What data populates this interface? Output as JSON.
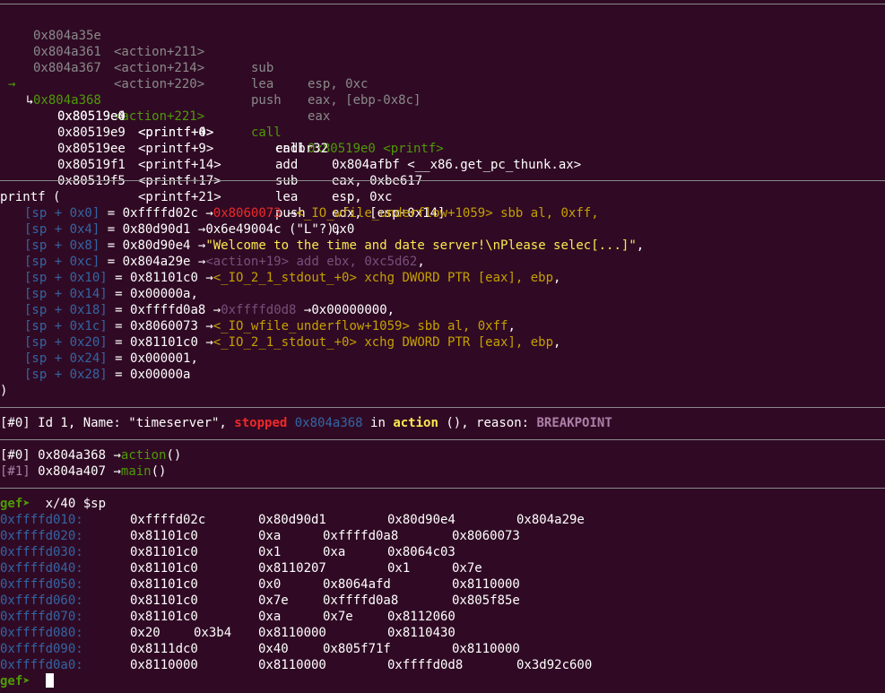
{
  "colors": {
    "background": "#300a24",
    "foreground": "#ffffff",
    "dim": "#8a8a8a",
    "green": "#4e9a06",
    "blue": "#3465a4",
    "red": "#ef2929",
    "orange": "#c4a000",
    "yellow": "#fce94f",
    "purple": "#75507b"
  },
  "disasm_prev": [
    {
      "addr": "0x804a35e",
      "sym": "<action+211>",
      "mnem": "sub",
      "ops": "esp, 0xc"
    },
    {
      "addr": "0x804a361",
      "sym": "<action+214>",
      "mnem": "lea",
      "ops": "eax, [ebp-0x8c]"
    },
    {
      "addr": "0x804a367",
      "sym": "<action+220>",
      "mnem": "push",
      "ops": "eax"
    }
  ],
  "disasm_current": {
    "marker": "→",
    "addr": "0x804a368",
    "sym": "<action+221>",
    "mnem": "call",
    "ops": "0x80519e0 <printf>"
  },
  "disasm_target": {
    "arrow": "↳",
    "first": {
      "addr": "0x80519e0",
      "sym": "<printf+0>",
      "mnem": "endbr32",
      "ops": ""
    },
    "rest": [
      {
        "addr": "0x80519e4",
        "sym": "<printf+4>",
        "mnem": "call",
        "ops": "0x804afbf <__x86.get_pc_thunk.ax>"
      },
      {
        "addr": "0x80519e9",
        "sym": "<printf+9>",
        "mnem": "add",
        "ops": "eax, 0xbe617"
      },
      {
        "addr": "0x80519ee",
        "sym": "<printf+14>",
        "mnem": "sub",
        "ops": "esp, 0xc"
      },
      {
        "addr": "0x80519f1",
        "sym": "<printf+17>",
        "mnem": "lea",
        "ops": "edx, [esp+0x14]"
      },
      {
        "addr": "0x80519f5",
        "sym": "<printf+21>",
        "mnem": "push",
        "ops": "0x0"
      }
    ]
  },
  "args": {
    "open": "printf (",
    "close": ")",
    "rows": [
      {
        "slot": "[sp + 0x0]",
        "val": "0xffffd02c",
        "arrow1": "→",
        "p1": "0x8060073",
        "arrow2": "→",
        "p2": "<_IO_wfile_underflow+1059> sbb al, 0xff,"
      },
      {
        "slot": "[sp + 0x4]",
        "val": "0x80d90d1",
        "arrow1": "→",
        "p1": "0x6e49004c",
        "p2": " (\"L\"?),"
      },
      {
        "slot": "[sp + 0x8]",
        "val": "0x80d90e4",
        "arrow1": "→",
        "p1": "\"Welcome to the time and date server!\\nPlease selec[...]\"",
        "p2": ","
      },
      {
        "slot": "[sp + 0xc]",
        "val": "0x804a29e",
        "arrow1": "→",
        "p1": "<action+19> add ebx, 0xc5d62",
        "p2": ","
      },
      {
        "slot": "[sp + 0x10]",
        "val": "0x81101c0",
        "arrow1": "→",
        "p1": "<_IO_2_1_stdout_+0> xchg DWORD PTR [eax], ebp",
        "p2": ","
      },
      {
        "slot": "[sp + 0x14]",
        "val": "0x00000a,",
        "arrow1": "",
        "p1": "",
        "p2": ""
      },
      {
        "slot": "[sp + 0x18]",
        "val": "0xffffd0a8",
        "arrow1": "→",
        "p1": "0xffffd0d8",
        "arrow2": "→",
        "p2": "0x00000000,"
      },
      {
        "slot": "[sp + 0x1c]",
        "val": "0x8060073",
        "arrow1": "→",
        "p1": "<_IO_wfile_underflow+1059> sbb al, 0xff",
        "p2": ","
      },
      {
        "slot": "[sp + 0x20]",
        "val": "0x81101c0",
        "arrow1": "→",
        "p1": "<_IO_2_1_stdout_+0> xchg DWORD PTR [eax], ebp",
        "p2": ","
      },
      {
        "slot": "[sp + 0x24]",
        "val": "0x000001,",
        "arrow1": "",
        "p1": "",
        "p2": ""
      },
      {
        "slot": "[sp + 0x28]",
        "val": "0x00000a",
        "arrow1": "",
        "p1": "",
        "p2": ""
      }
    ]
  },
  "threads": {
    "idx": "[#0]",
    "id_text": " Id 1, Name: \"timeserver\", ",
    "state": "stopped",
    "addr": "0x804a368",
    "in_text": " in ",
    "func": "action",
    "reason_text": " (), reason: ",
    "reason": "BREAKPOINT"
  },
  "trace": [
    {
      "idx": "[#0]",
      "addr": "0x804a368",
      "arrow": "→",
      "func": "action",
      "paren": "()"
    },
    {
      "idx": "[#1]",
      "addr": "0x804a407",
      "arrow": "→",
      "func": "main",
      "paren": "()"
    }
  ],
  "prompt": {
    "label": "gef➤",
    "command": "  x/40 $sp"
  },
  "memory": [
    {
      "addr": "0xffffd010:",
      "c": [
        "0xffffd02c",
        "0x80d90d1",
        "0x80d90e4",
        "0x804a29e"
      ]
    },
    {
      "addr": "0xffffd020:",
      "c": [
        "0x81101c0",
        "0xa",
        "0xffffd0a8",
        "0x8060073"
      ]
    },
    {
      "addr": "0xffffd030:",
      "c": [
        "0x81101c0",
        "0x1",
        "0xa",
        "0x8064c03"
      ]
    },
    {
      "addr": "0xffffd040:",
      "c": [
        "0x81101c0",
        "0x8110207",
        "0x1",
        "0x7e"
      ]
    },
    {
      "addr": "0xffffd050:",
      "c": [
        "0x81101c0",
        "0x0",
        "0x8064afd",
        "0x8110000"
      ]
    },
    {
      "addr": "0xffffd060:",
      "c": [
        "0x81101c0",
        "0x7e",
        "0xffffd0a8",
        "0x805f85e"
      ]
    },
    {
      "addr": "0xffffd070:",
      "c": [
        "0x81101c0",
        "0xa",
        "0x7e",
        "0x8112060"
      ]
    },
    {
      "addr": "0xffffd080:",
      "c": [
        "0x20",
        "0x3b4",
        "0x8110000",
        "0x8110430"
      ]
    },
    {
      "addr": "0xffffd090:",
      "c": [
        "0x8111dc0",
        "0x40",
        "0x805f71f",
        "0x8110000"
      ]
    },
    {
      "addr": "0xffffd0a0:",
      "c": [
        "0x8110000",
        "0x8110000",
        "0xffffd0d8",
        "0x3d92c600"
      ]
    }
  ],
  "final_prompt": {
    "label": "gef➤"
  }
}
